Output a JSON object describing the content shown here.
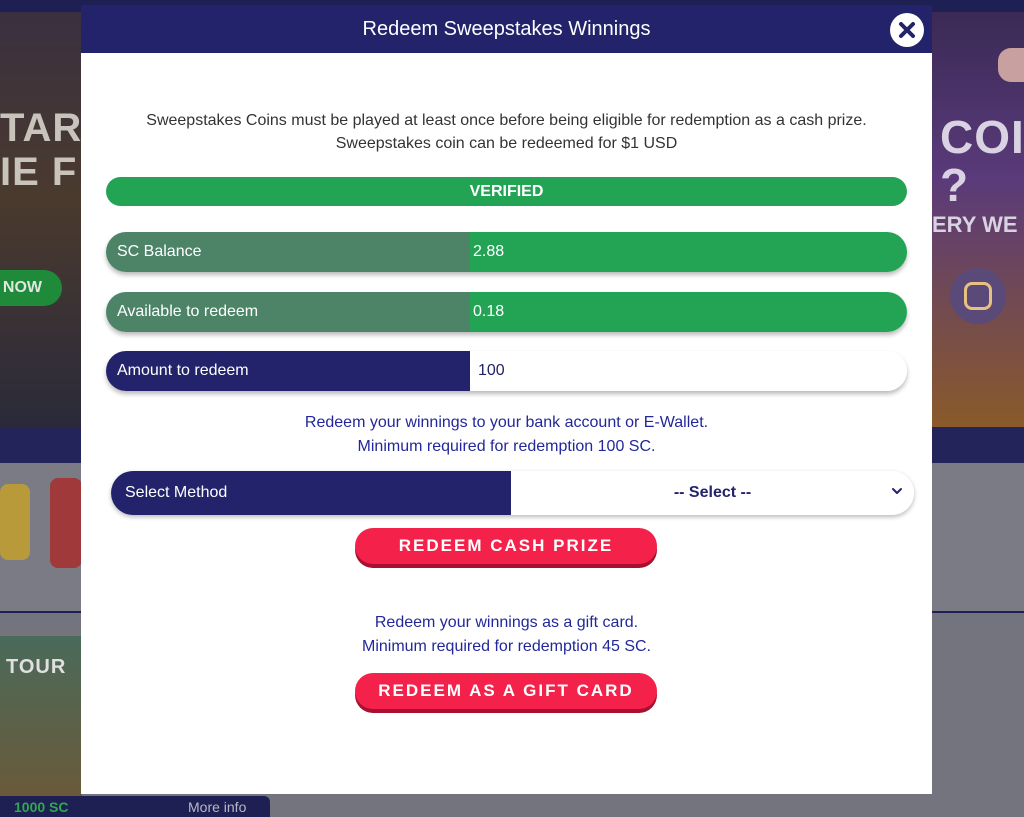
{
  "background": {
    "hero_left_line1": "TAR",
    "hero_left_line2": "IE F",
    "hero_left_button": "NOW",
    "hero_right_line1": "COI",
    "hero_right_line2": "?",
    "hero_right_line3": "ERY WE",
    "tour_text": "TOUR",
    "bottom_sc": "1000 SC",
    "bottom_more_info": "More info"
  },
  "modal": {
    "title": "Redeem Sweepstakes Winnings",
    "close_icon": "close-icon",
    "notice_line1": "Sweepstakes Coins must be played at least once before being eligible for redemption as a cash prize.",
    "notice_line2": "Sweepstakes coin can be redeemed for $1 USD",
    "verified_label": "VERIFIED",
    "sc_balance": {
      "label": "SC Balance",
      "value": "2.88"
    },
    "available": {
      "label": "Available to redeem",
      "value": "0.18"
    },
    "amount": {
      "label": "Amount to redeem",
      "value": "100"
    },
    "bank_info_line1": "Redeem your winnings to your bank account or E-Wallet.",
    "bank_info_line2": "Minimum required for redemption 100 SC.",
    "method": {
      "label": "Select Method",
      "selected": "-- Select --"
    },
    "redeem_cash_label": "REDEEM CASH PRIZE",
    "gift_info_line1": "Redeem your winnings as a gift card.",
    "gift_info_line2": "Minimum required for redemption 45 SC.",
    "redeem_gift_label": "REDEEM AS A GIFT CARD"
  },
  "colors": {
    "header": "#22236a",
    "verified_green": "#23a455",
    "muted_green": "#4d8468",
    "redeem_red": "#f4224a",
    "info_blue": "#22289a"
  }
}
